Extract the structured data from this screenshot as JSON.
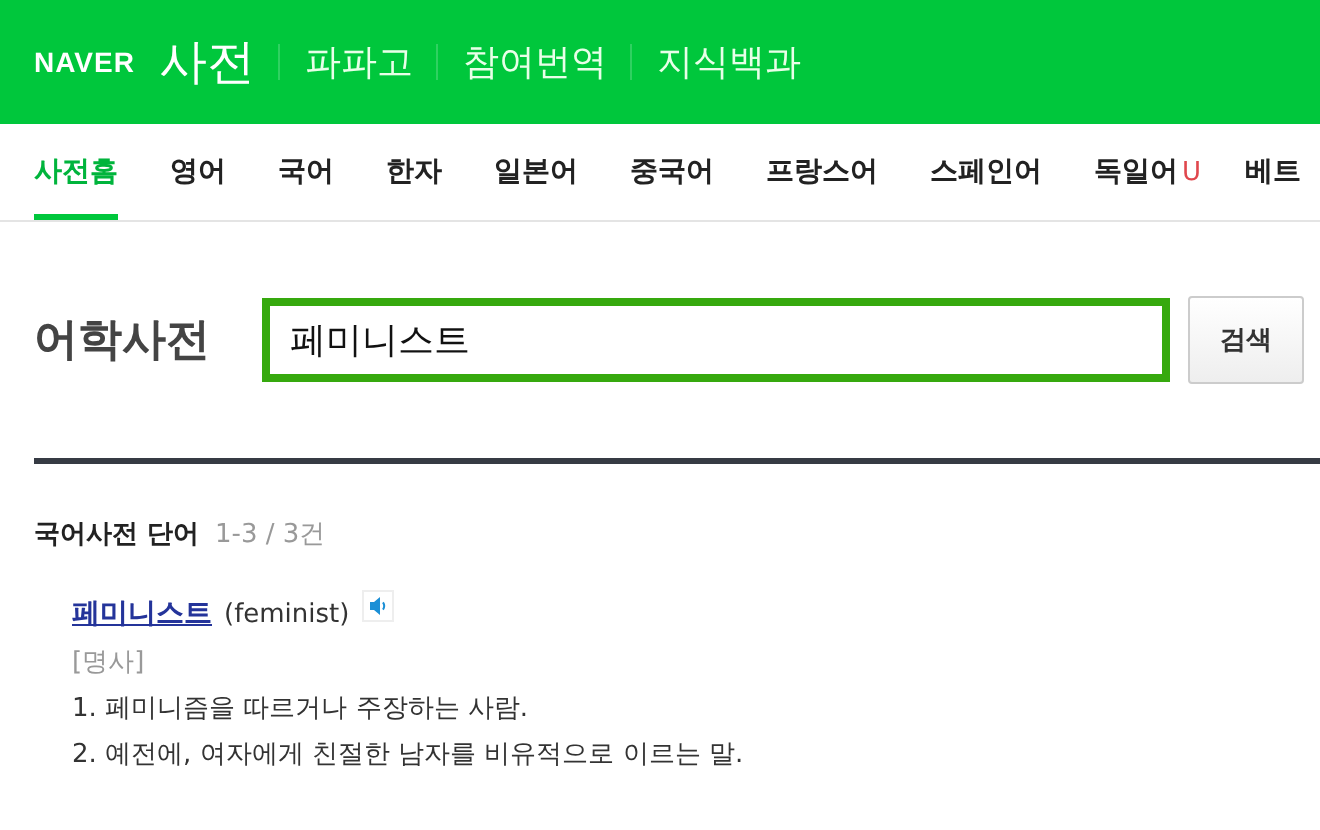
{
  "header": {
    "logo": "NAVER",
    "service": "사전",
    "links": [
      "파파고",
      "참여번역",
      "지식백과"
    ]
  },
  "tabs": [
    {
      "label": "사전홈",
      "selected": true
    },
    {
      "label": "영어",
      "selected": false
    },
    {
      "label": "국어",
      "selected": false
    },
    {
      "label": "한자",
      "selected": false
    },
    {
      "label": "일본어",
      "selected": false
    },
    {
      "label": "중국어",
      "selected": false
    },
    {
      "label": "프랑스어",
      "selected": false
    },
    {
      "label": "스페인어",
      "selected": false
    },
    {
      "label": "독일어",
      "selected": false,
      "badge": "U"
    },
    {
      "label": "베트",
      "selected": false
    }
  ],
  "search": {
    "title": "어학사전",
    "value": "페미니스트",
    "button": "검색"
  },
  "results": {
    "heading": "국어사전 단어",
    "count": "1-3 / 3건",
    "entries": [
      {
        "word": "페미니스트",
        "origin": "(feminist)",
        "pos": "[명사]",
        "senses": [
          "1. 페미니즘을 따르거나 주장하는 사람.",
          "2. 예전에, 여자에게 친절한 남자를 비유적으로 이르는 말."
        ]
      }
    ]
  }
}
